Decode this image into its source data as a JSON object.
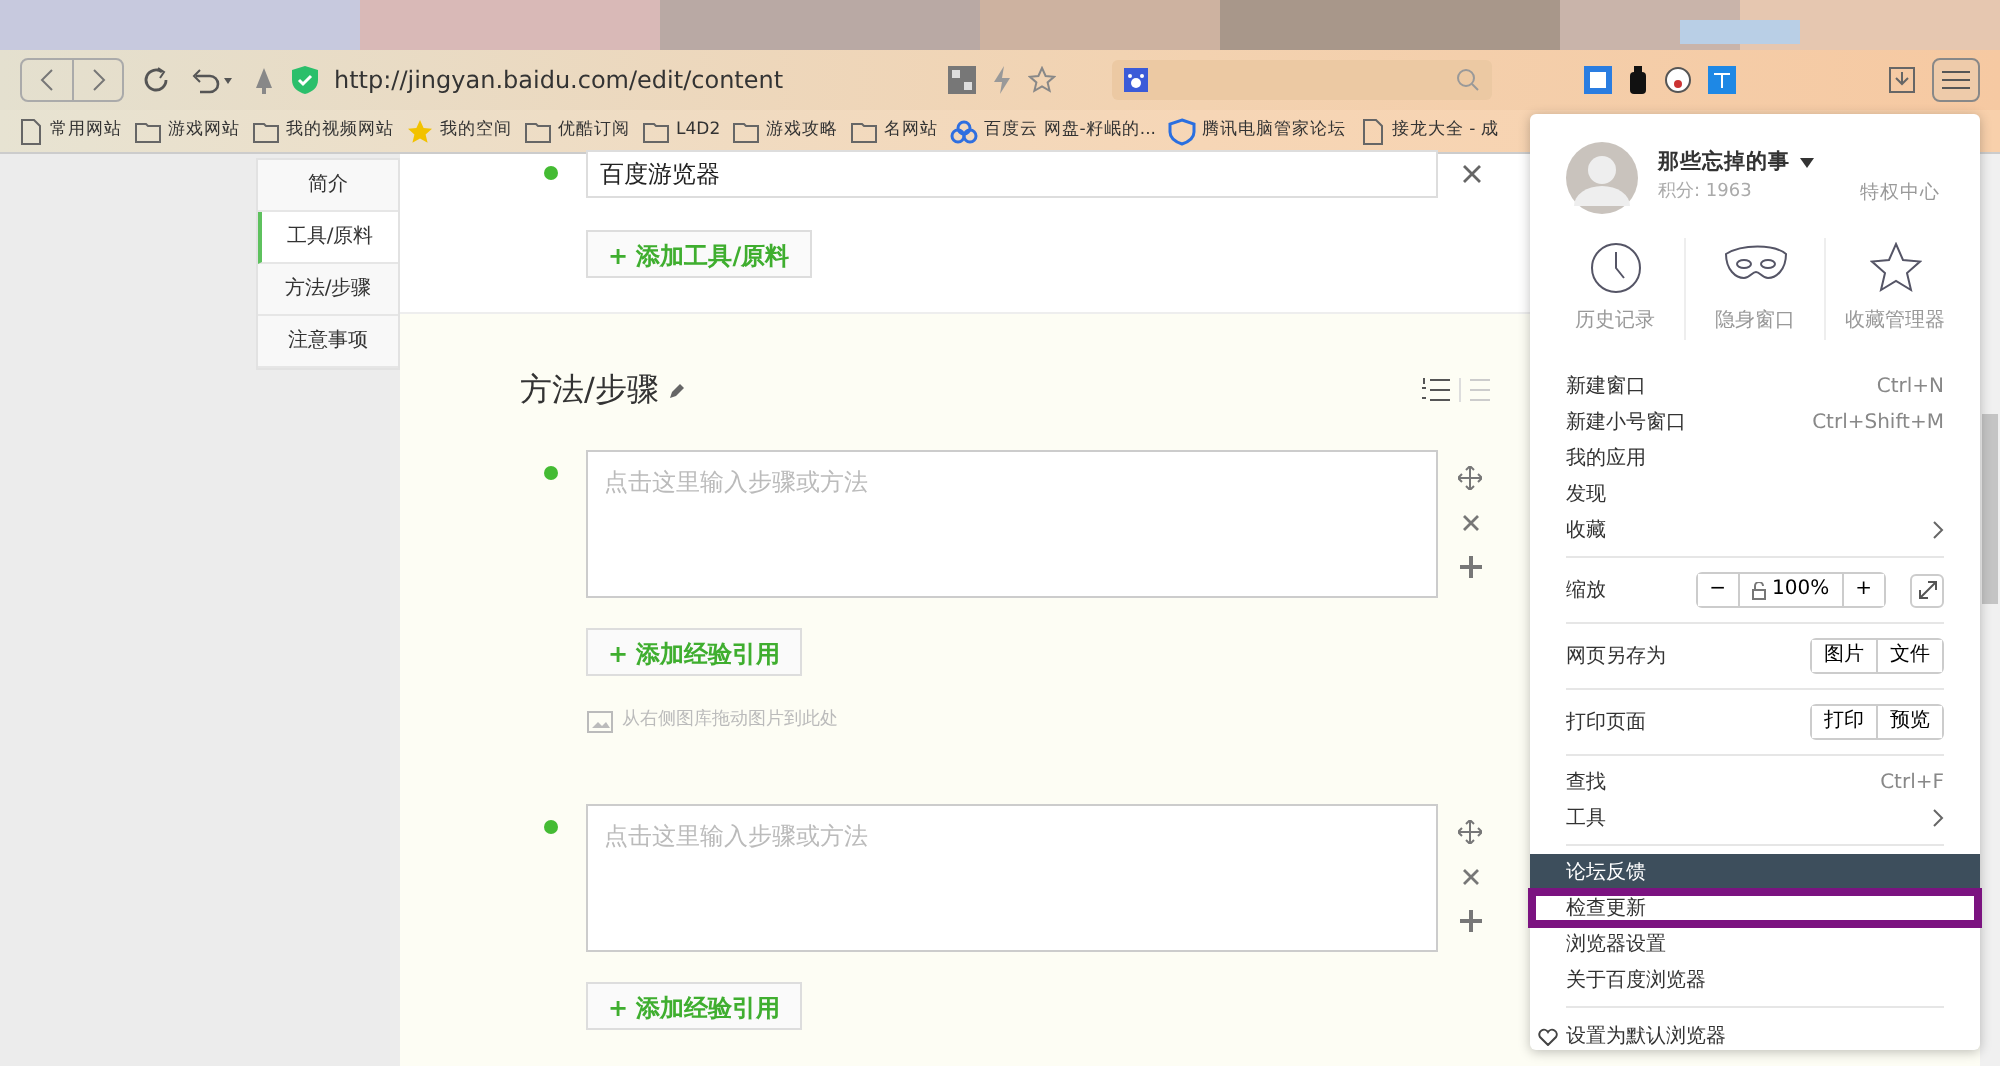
{
  "toolbar": {
    "url": "http://jingyan.baidu.com/edit/content"
  },
  "bookmarks": [
    {
      "label": "常用网站",
      "kind": "page"
    },
    {
      "label": "游戏网站",
      "kind": "folder"
    },
    {
      "label": "我的视频网站",
      "kind": "folder"
    },
    {
      "label": "我的空间",
      "kind": "star"
    },
    {
      "label": "优酷订阅",
      "kind": "folder"
    },
    {
      "label": "L4D2",
      "kind": "folder"
    },
    {
      "label": "游戏攻略",
      "kind": "folder"
    },
    {
      "label": "名网站",
      "kind": "folder"
    },
    {
      "label": "百度云 网盘-籽岷的...",
      "kind": "cloud"
    },
    {
      "label": "腾讯电脑管家论坛",
      "kind": "shield"
    },
    {
      "label": "接龙大全 - 成",
      "kind": "page"
    }
  ],
  "sidebar": {
    "items": [
      {
        "label": "简介",
        "selected": false
      },
      {
        "label": "工具/原料",
        "selected": true
      },
      {
        "label": "方法/步骤",
        "selected": false
      },
      {
        "label": "注意事项",
        "selected": false
      }
    ]
  },
  "tools": {
    "items": [
      {
        "value": "百度游览器"
      }
    ],
    "add_button": "+ 添加工具/原料"
  },
  "steps_section": {
    "title": "方法/步骤",
    "steps": [
      {
        "placeholder": "点击这里输入步骤或方法",
        "add_button": "+ 添加经验引用",
        "image_hint": "从右侧图库拖动图片到此处"
      },
      {
        "placeholder": "点击这里输入步骤或方法",
        "add_button": "+ 添加经验引用"
      }
    ]
  },
  "menu": {
    "user": {
      "name": "那些忘掉的事",
      "points": "积分: 1963",
      "link": "特权中心"
    },
    "quick": [
      {
        "label": "历史记录",
        "kind": "clock"
      },
      {
        "label": "隐身窗口",
        "kind": "mask"
      },
      {
        "label": "收藏管理器",
        "kind": "star"
      }
    ],
    "groups": [
      [
        {
          "kind": "item",
          "label": "新建窗口",
          "shortcut": "Ctrl+N",
          "submenu": false,
          "active": false,
          "outlined": false
        },
        {
          "kind": "item",
          "label": "新建小号窗口",
          "shortcut": "Ctrl+Shift+M",
          "submenu": false,
          "active": false,
          "outlined": false
        },
        {
          "kind": "item",
          "label": "我的应用",
          "submenu": false,
          "active": false,
          "outlined": false
        },
        {
          "kind": "item",
          "label": "发现",
          "submenu": false,
          "active": false,
          "outlined": false
        },
        {
          "kind": "item",
          "label": "收藏",
          "submenu": true,
          "active": false,
          "outlined": false
        }
      ],
      [
        {
          "kind": "zoom",
          "label": "缩放",
          "minus": "−",
          "value": "100%",
          "plus": "+"
        }
      ],
      [
        {
          "kind": "buttons",
          "label": "网页另存为",
          "buttons": [
            "图片",
            "文件"
          ]
        }
      ],
      [
        {
          "kind": "buttons",
          "label": "打印页面",
          "buttons": [
            "打印",
            "预览"
          ]
        }
      ],
      [
        {
          "kind": "item",
          "label": "查找",
          "shortcut": "Ctrl+F",
          "submenu": false,
          "active": false,
          "outlined": false
        },
        {
          "kind": "item",
          "label": "工具",
          "submenu": true,
          "active": false,
          "outlined": false
        }
      ],
      [
        {
          "kind": "item",
          "label": "论坛反馈",
          "submenu": false,
          "active": true,
          "outlined": false
        },
        {
          "kind": "item",
          "label": "检查更新",
          "submenu": false,
          "active": false,
          "outlined": true
        },
        {
          "kind": "item",
          "label": "浏览器设置",
          "submenu": false,
          "active": false,
          "outlined": false
        },
        {
          "kind": "item",
          "label": "关于百度浏览器",
          "submenu": false,
          "active": false,
          "outlined": false
        }
      ],
      [
        {
          "kind": "default",
          "label": "设置为默认浏览器"
        }
      ]
    ]
  }
}
